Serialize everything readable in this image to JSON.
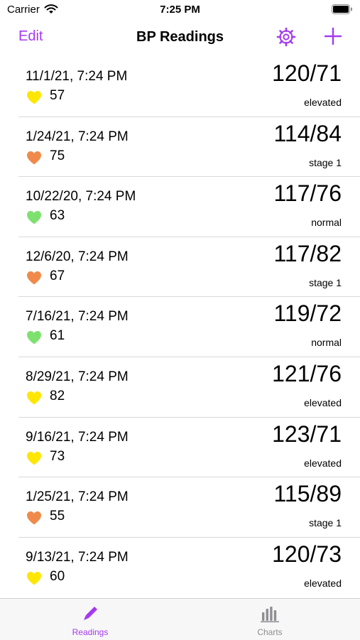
{
  "status_bar": {
    "carrier": "Carrier",
    "time": "7:25 PM"
  },
  "nav": {
    "edit_label": "Edit",
    "title": "BP Readings"
  },
  "colors": {
    "accent": "#a43af0",
    "heart_yellow": "#ffe600",
    "heart_orange": "#f08a4b",
    "heart_green": "#7ee06f"
  },
  "readings": [
    {
      "date": "11/1/21, 7:24 PM",
      "pulse": "57",
      "bp": "120/71",
      "category": "elevated",
      "heart_color": "yellow"
    },
    {
      "date": "1/24/21, 7:24 PM",
      "pulse": "75",
      "bp": "114/84",
      "category": "stage 1",
      "heart_color": "orange"
    },
    {
      "date": "10/22/20, 7:24 PM",
      "pulse": "63",
      "bp": "117/76",
      "category": "normal",
      "heart_color": "green"
    },
    {
      "date": "12/6/20, 7:24 PM",
      "pulse": "67",
      "bp": "117/82",
      "category": "stage 1",
      "heart_color": "orange"
    },
    {
      "date": "7/16/21, 7:24 PM",
      "pulse": "61",
      "bp": "119/72",
      "category": "normal",
      "heart_color": "green"
    },
    {
      "date": "8/29/21, 7:24 PM",
      "pulse": "82",
      "bp": "121/76",
      "category": "elevated",
      "heart_color": "yellow"
    },
    {
      "date": "9/16/21, 7:24 PM",
      "pulse": "73",
      "bp": "123/71",
      "category": "elevated",
      "heart_color": "yellow"
    },
    {
      "date": "1/25/21, 7:24 PM",
      "pulse": "55",
      "bp": "115/89",
      "category": "stage 1",
      "heart_color": "orange"
    },
    {
      "date": "9/13/21, 7:24 PM",
      "pulse": "60",
      "bp": "120/73",
      "category": "elevated",
      "heart_color": "yellow"
    }
  ],
  "tabs": [
    {
      "label": "Readings",
      "icon": "pencil-icon",
      "selected": true
    },
    {
      "label": "Charts",
      "icon": "bar-chart-icon",
      "selected": false
    }
  ]
}
